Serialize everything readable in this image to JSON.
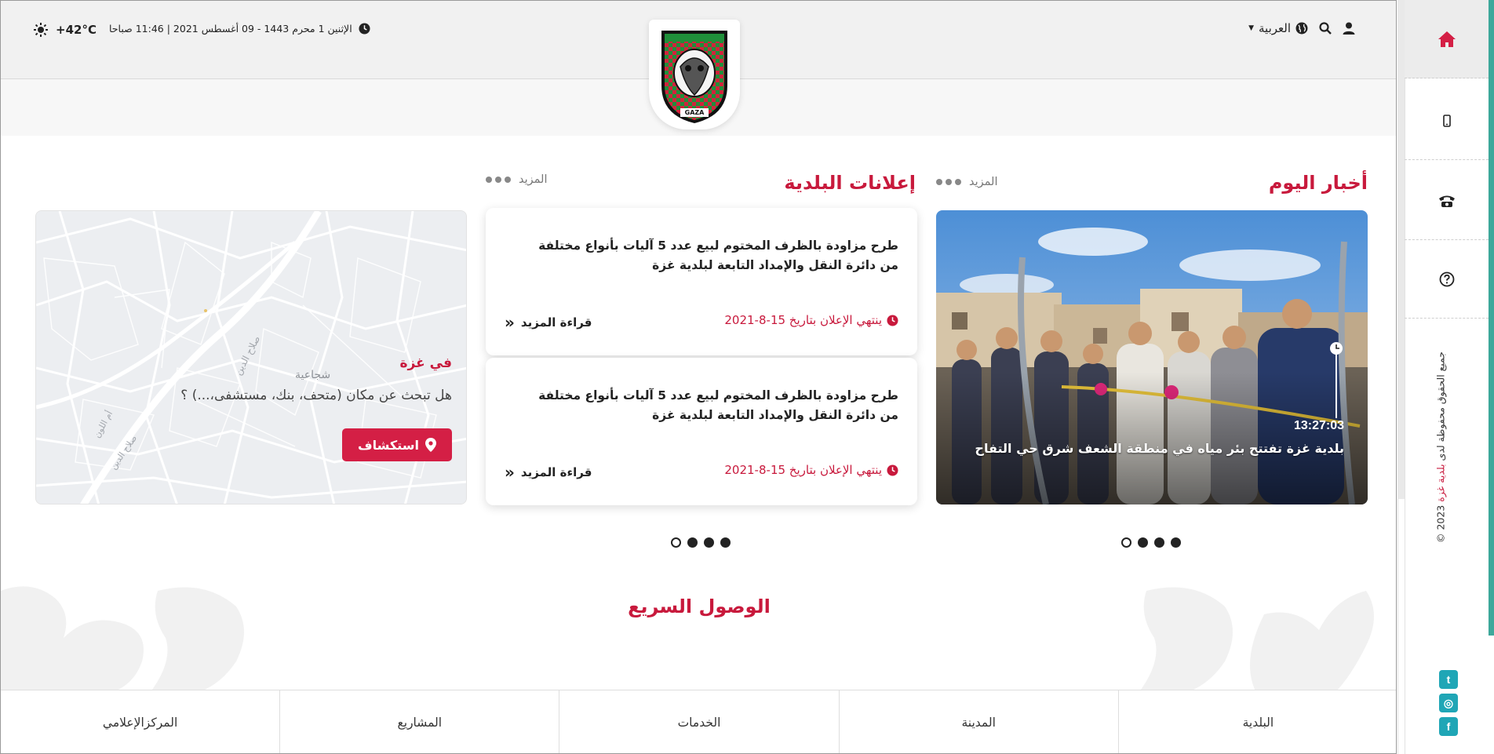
{
  "header": {
    "temperature": "+42°C",
    "datetime": "الإثنين 1 محرم 1443 - 09 أغسطس 2021 | 11:46 صباحا",
    "language": "العربية",
    "logo_text": "GAZA"
  },
  "news": {
    "title": "أخبار اليوم",
    "more_label": "المزيد",
    "item": {
      "time": "13:27:03",
      "headline": "بلدية غزة تفتتح بئر مياه في منطقة الشعف شرق حي التفاح"
    }
  },
  "announcements": {
    "title": "إعلانات البلدية",
    "more_label": "المزيد",
    "items": [
      {
        "text": "طرح مزاودة بالظرف المختوم لبيع عدد 5 آليات بأنواع مختلفة من دائرة النقل والإمداد التابعة لبلدية غزة",
        "date": "ينتهي الإعلان بتاريخ 15-8-2021",
        "read_more": "قراءة المزيد"
      },
      {
        "text": "طرح مزاودة بالظرف المختوم لبيع عدد 5 آليات بأنواع مختلفة من دائرة النقل والإمداد التابعة لبلدية غزة",
        "date": "ينتهي الإعلان بتاريخ 15-8-2021",
        "read_more": "قراءة المزيد"
      }
    ]
  },
  "map_widget": {
    "city": "في غزة",
    "question": "هل تبحث عن مكان (متحف، بنك، مستشفى،...) ؟",
    "explore_label": "استكشاف",
    "street_labels": [
      "صلاح الدين",
      "شجاعية",
      "أم اللون",
      "صلاح الدين"
    ]
  },
  "quick_access": {
    "title": "الوصول السريع"
  },
  "tabs": [
    "البلدية",
    "المدينة",
    "الخدمات",
    "المشاريع",
    "المركزالإعلامي"
  ],
  "sidebar": {
    "icons": [
      "home-icon",
      "mobile-icon",
      "phone-icon",
      "help-icon"
    ],
    "copyright_prefix": "جميع الحقوق محفوظة لدى",
    "copyright_owner": "بلدية غزة",
    "copyright_year": "2023 ©",
    "social": [
      {
        "name": "twitter",
        "glyph": "t"
      },
      {
        "name": "instagram",
        "glyph": "◎"
      },
      {
        "name": "facebook",
        "glyph": "f"
      }
    ]
  },
  "colors": {
    "accent": "#c8193c",
    "button": "#d41f45",
    "rail_accent": "#3ea89b"
  }
}
